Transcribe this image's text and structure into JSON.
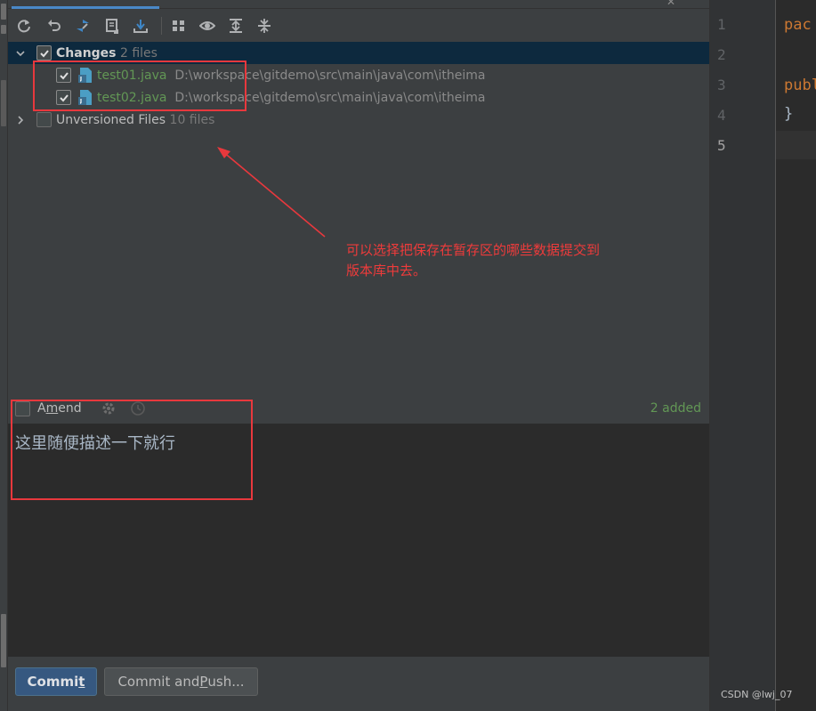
{
  "toolbar": {
    "icons": [
      "refresh-icon",
      "rollback-icon",
      "diff-icon",
      "shelve-icon",
      "update-icon",
      "group-by-icon",
      "eye-icon",
      "expand-all-icon",
      "collapse-all-icon"
    ]
  },
  "tree": {
    "changes": {
      "label": "Changes",
      "count": "2 files",
      "checked": true
    },
    "files": [
      {
        "name": "test01.java",
        "path": "D:\\workspace\\gitdemo\\src\\main\\java\\com\\itheima",
        "checked": true
      },
      {
        "name": "test02.java",
        "path": "D:\\workspace\\gitdemo\\src\\main\\java\\com\\itheima",
        "checked": true
      }
    ],
    "unversioned": {
      "label": "Unversioned Files",
      "count": "10 files",
      "checked": false
    }
  },
  "annotation": {
    "text_line1": "可以选择把保存在暂存区的哪些数据提交到",
    "text_line2": "版本库中去。"
  },
  "commit": {
    "amend_label_pre": "A",
    "amend_label_mnemonic": "m",
    "amend_label_post": "end",
    "status": "2 added",
    "message": "这里随便描述一下就行",
    "commit_label_pre": "Commi",
    "commit_label_mnemonic": "t",
    "commit_push_pre": "Commit and ",
    "commit_push_mnemonic": "P",
    "commit_push_post": "ush..."
  },
  "editor": {
    "line_numbers": [
      "1",
      "2",
      "3",
      "4",
      "5"
    ],
    "code": [
      {
        "text": "pac",
        "class": "kw"
      },
      {
        "text": "",
        "class": "plain"
      },
      {
        "text": "publ",
        "class": "kw"
      },
      {
        "text": "}",
        "class": "plain"
      },
      {
        "text": "",
        "class": "plain"
      }
    ]
  },
  "watermark": "CSDN @lwj_07",
  "colors": {
    "accent": "#4a88c7",
    "annotation_red": "#e8383d",
    "added_green": "#629755",
    "selection": "#0d293e"
  }
}
